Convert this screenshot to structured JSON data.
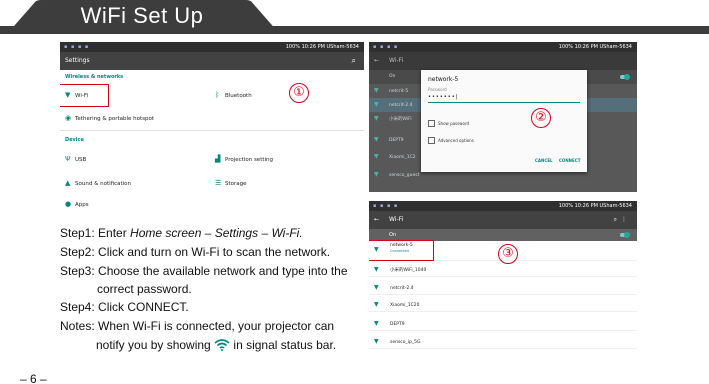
{
  "header": {
    "title": "WiFi Set Up"
  },
  "page_number": "– 6 –",
  "shot1": {
    "status_right": "100%  10:26 PM  USham-5634",
    "appbar_title": "Settings",
    "section_wireless": "Wireless & networks",
    "item_wifi": "Wi-Fi",
    "item_bluetooth": "Bluetooth",
    "item_tethering": "Tethering & portable hotspot",
    "section_device": "Device",
    "item_usb": "USB",
    "item_projection": "Projection setting",
    "item_sound": "Sound & notification",
    "item_storage": "Storage",
    "item_apps": "Apps",
    "callout": "①"
  },
  "shot2": {
    "status_right": "100%  10:26 PM  USham-5634",
    "appbar_title": "Wi-Fi",
    "on_label": "On",
    "networks": [
      "netcrit-5",
      "netcrit-2.4",
      "小米的WiFi",
      "DEPT9",
      "Xiaomi_1C2",
      "sensco_guest"
    ],
    "dialog_title": "network-5",
    "dialog_password_label": "Password",
    "dialog_password_value": "•••••••|",
    "dialog_show_password": "Show password",
    "dialog_advanced": "Advanced options",
    "dialog_cancel": "CANCEL",
    "dialog_connect": "CONNECT",
    "callout": "②"
  },
  "shot3": {
    "status_right": "100%  10:26 PM  USham-5634",
    "appbar_title": "Wi-Fi",
    "on_label": "On",
    "connected_name": "network-5",
    "connected_status": "Connected",
    "networks": [
      "小米的WiFi_1040",
      "netcrit-2.4",
      "Xiaomi_1C20",
      "DEPT9",
      "sensco_ip_5G"
    ],
    "callout": "③"
  },
  "steps": {
    "step1_prefix": "Step1: Enter ",
    "step1_italic": "Home screen – Settings – Wi-Fi.",
    "step2": "Step2: Click and turn on Wi-Fi to scan the network.",
    "step3_line1": "Step3: Choose the available network and type into the",
    "step3_line2": "correct password.",
    "step4": "Step4: Click CONNECT.",
    "notes_line1": "Notes: When Wi-Fi is connected, your projector can",
    "notes_line2_a": "notify you by showing",
    "notes_line2_b": "in signal status bar."
  },
  "colors": {
    "header": "#3d3d3d",
    "callout": "#d6001c",
    "accent": "#00897b"
  }
}
